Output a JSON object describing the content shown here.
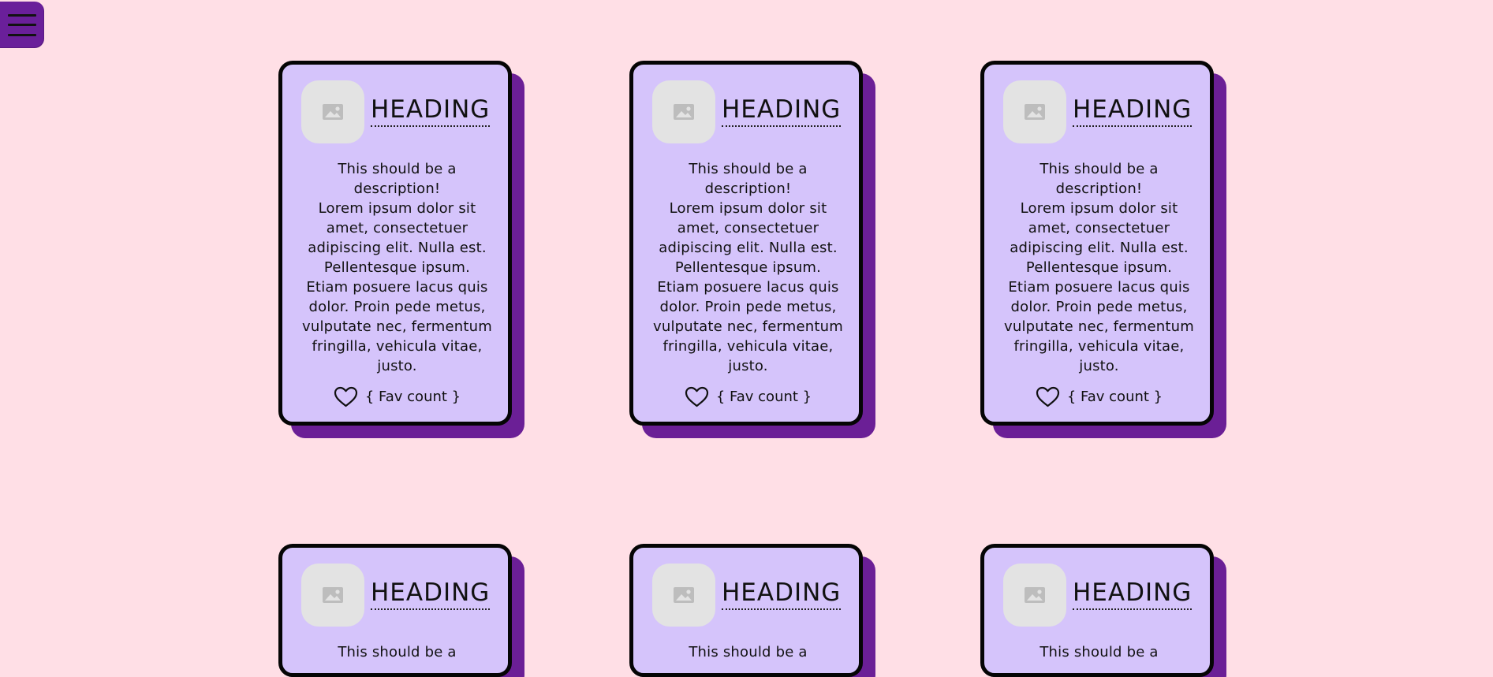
{
  "menu": {
    "icon": "hamburger-menu-icon"
  },
  "cards": [
    {
      "heading": "HEADING",
      "description_lines": [
        "This should be a",
        "description!",
        "Lorem ipsum dolor sit",
        "amet, consectetuer",
        "adipiscing elit. Nulla est.",
        "Pellentesque ipsum.",
        "Etiam posuere lacus quis",
        "dolor. Proin pede metus,",
        "vulputate nec, fermentum",
        "fringilla, vehicula vitae,",
        "justo."
      ],
      "fav_label": "{ Fav count }"
    },
    {
      "heading": "HEADING",
      "description_lines": [
        "This should be a",
        "description!",
        "Lorem ipsum dolor sit",
        "amet, consectetuer",
        "adipiscing elit. Nulla est.",
        "Pellentesque ipsum.",
        "Etiam posuere lacus quis",
        "dolor. Proin pede metus,",
        "vulputate nec, fermentum",
        "fringilla, vehicula vitae,",
        "justo."
      ],
      "fav_label": "{ Fav count }"
    },
    {
      "heading": "HEADING",
      "description_lines": [
        "This should be a",
        "description!",
        "Lorem ipsum dolor sit",
        "amet, consectetuer",
        "adipiscing elit. Nulla est.",
        "Pellentesque ipsum.",
        "Etiam posuere lacus quis",
        "dolor. Proin pede metus,",
        "vulputate nec, fermentum",
        "fringilla, vehicula vitae,",
        "justo."
      ],
      "fav_label": "{ Fav count }"
    },
    {
      "heading": "HEADING",
      "description_lines": [
        "This should be a"
      ],
      "fav_label": ""
    },
    {
      "heading": "HEADING",
      "description_lines": [
        "This should be a"
      ],
      "fav_label": ""
    },
    {
      "heading": "HEADING",
      "description_lines": [
        "This should be a"
      ],
      "fav_label": ""
    }
  ],
  "icons": {
    "image_placeholder": "image-icon",
    "favorite": "heart-icon"
  },
  "colors": {
    "background": "#ffdfe6",
    "card_fill": "#d5c4fb",
    "card_shadow": "#6b1f96",
    "menu_fill": "#6a1f9a",
    "border": "#050505"
  }
}
